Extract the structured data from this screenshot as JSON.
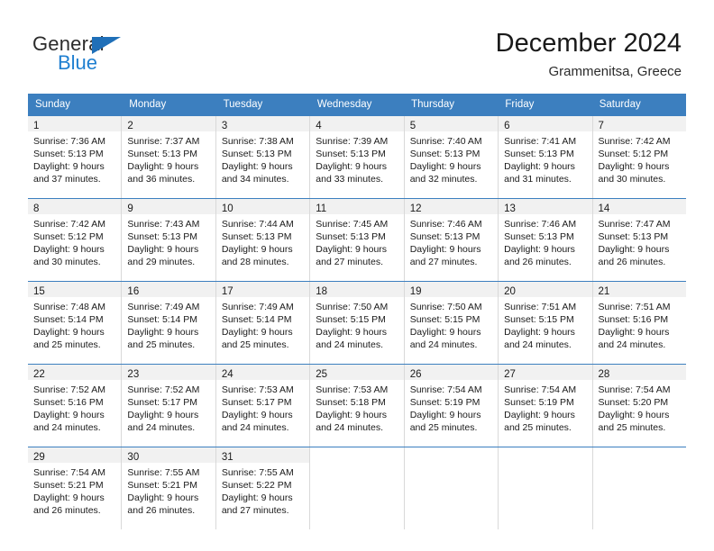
{
  "brand": {
    "word_one": "General",
    "word_two": "Blue",
    "triangle_icon": "triangle-icon",
    "accent_color": "#1f7fd0"
  },
  "header": {
    "title": "December 2024",
    "subtitle": "Grammenitsa, Greece"
  },
  "calendar": {
    "header_bg": "#3c7fbf",
    "daynum_bg": "#f1f1f1",
    "weekdays": [
      "Sunday",
      "Monday",
      "Tuesday",
      "Wednesday",
      "Thursday",
      "Friday",
      "Saturday"
    ],
    "weeks": [
      [
        {
          "day": "1",
          "sunrise": "Sunrise: 7:36 AM",
          "sunset": "Sunset: 5:13 PM",
          "daylight_1": "Daylight: 9 hours",
          "daylight_2": "and 37 minutes."
        },
        {
          "day": "2",
          "sunrise": "Sunrise: 7:37 AM",
          "sunset": "Sunset: 5:13 PM",
          "daylight_1": "Daylight: 9 hours",
          "daylight_2": "and 36 minutes."
        },
        {
          "day": "3",
          "sunrise": "Sunrise: 7:38 AM",
          "sunset": "Sunset: 5:13 PM",
          "daylight_1": "Daylight: 9 hours",
          "daylight_2": "and 34 minutes."
        },
        {
          "day": "4",
          "sunrise": "Sunrise: 7:39 AM",
          "sunset": "Sunset: 5:13 PM",
          "daylight_1": "Daylight: 9 hours",
          "daylight_2": "and 33 minutes."
        },
        {
          "day": "5",
          "sunrise": "Sunrise: 7:40 AM",
          "sunset": "Sunset: 5:13 PM",
          "daylight_1": "Daylight: 9 hours",
          "daylight_2": "and 32 minutes."
        },
        {
          "day": "6",
          "sunrise": "Sunrise: 7:41 AM",
          "sunset": "Sunset: 5:13 PM",
          "daylight_1": "Daylight: 9 hours",
          "daylight_2": "and 31 minutes."
        },
        {
          "day": "7",
          "sunrise": "Sunrise: 7:42 AM",
          "sunset": "Sunset: 5:12 PM",
          "daylight_1": "Daylight: 9 hours",
          "daylight_2": "and 30 minutes."
        }
      ],
      [
        {
          "day": "8",
          "sunrise": "Sunrise: 7:42 AM",
          "sunset": "Sunset: 5:12 PM",
          "daylight_1": "Daylight: 9 hours",
          "daylight_2": "and 30 minutes."
        },
        {
          "day": "9",
          "sunrise": "Sunrise: 7:43 AM",
          "sunset": "Sunset: 5:13 PM",
          "daylight_1": "Daylight: 9 hours",
          "daylight_2": "and 29 minutes."
        },
        {
          "day": "10",
          "sunrise": "Sunrise: 7:44 AM",
          "sunset": "Sunset: 5:13 PM",
          "daylight_1": "Daylight: 9 hours",
          "daylight_2": "and 28 minutes."
        },
        {
          "day": "11",
          "sunrise": "Sunrise: 7:45 AM",
          "sunset": "Sunset: 5:13 PM",
          "daylight_1": "Daylight: 9 hours",
          "daylight_2": "and 27 minutes."
        },
        {
          "day": "12",
          "sunrise": "Sunrise: 7:46 AM",
          "sunset": "Sunset: 5:13 PM",
          "daylight_1": "Daylight: 9 hours",
          "daylight_2": "and 27 minutes."
        },
        {
          "day": "13",
          "sunrise": "Sunrise: 7:46 AM",
          "sunset": "Sunset: 5:13 PM",
          "daylight_1": "Daylight: 9 hours",
          "daylight_2": "and 26 minutes."
        },
        {
          "day": "14",
          "sunrise": "Sunrise: 7:47 AM",
          "sunset": "Sunset: 5:13 PM",
          "daylight_1": "Daylight: 9 hours",
          "daylight_2": "and 26 minutes."
        }
      ],
      [
        {
          "day": "15",
          "sunrise": "Sunrise: 7:48 AM",
          "sunset": "Sunset: 5:14 PM",
          "daylight_1": "Daylight: 9 hours",
          "daylight_2": "and 25 minutes."
        },
        {
          "day": "16",
          "sunrise": "Sunrise: 7:49 AM",
          "sunset": "Sunset: 5:14 PM",
          "daylight_1": "Daylight: 9 hours",
          "daylight_2": "and 25 minutes."
        },
        {
          "day": "17",
          "sunrise": "Sunrise: 7:49 AM",
          "sunset": "Sunset: 5:14 PM",
          "daylight_1": "Daylight: 9 hours",
          "daylight_2": "and 25 minutes."
        },
        {
          "day": "18",
          "sunrise": "Sunrise: 7:50 AM",
          "sunset": "Sunset: 5:15 PM",
          "daylight_1": "Daylight: 9 hours",
          "daylight_2": "and 24 minutes."
        },
        {
          "day": "19",
          "sunrise": "Sunrise: 7:50 AM",
          "sunset": "Sunset: 5:15 PM",
          "daylight_1": "Daylight: 9 hours",
          "daylight_2": "and 24 minutes."
        },
        {
          "day": "20",
          "sunrise": "Sunrise: 7:51 AM",
          "sunset": "Sunset: 5:15 PM",
          "daylight_1": "Daylight: 9 hours",
          "daylight_2": "and 24 minutes."
        },
        {
          "day": "21",
          "sunrise": "Sunrise: 7:51 AM",
          "sunset": "Sunset: 5:16 PM",
          "daylight_1": "Daylight: 9 hours",
          "daylight_2": "and 24 minutes."
        }
      ],
      [
        {
          "day": "22",
          "sunrise": "Sunrise: 7:52 AM",
          "sunset": "Sunset: 5:16 PM",
          "daylight_1": "Daylight: 9 hours",
          "daylight_2": "and 24 minutes."
        },
        {
          "day": "23",
          "sunrise": "Sunrise: 7:52 AM",
          "sunset": "Sunset: 5:17 PM",
          "daylight_1": "Daylight: 9 hours",
          "daylight_2": "and 24 minutes."
        },
        {
          "day": "24",
          "sunrise": "Sunrise: 7:53 AM",
          "sunset": "Sunset: 5:17 PM",
          "daylight_1": "Daylight: 9 hours",
          "daylight_2": "and 24 minutes."
        },
        {
          "day": "25",
          "sunrise": "Sunrise: 7:53 AM",
          "sunset": "Sunset: 5:18 PM",
          "daylight_1": "Daylight: 9 hours",
          "daylight_2": "and 24 minutes."
        },
        {
          "day": "26",
          "sunrise": "Sunrise: 7:54 AM",
          "sunset": "Sunset: 5:19 PM",
          "daylight_1": "Daylight: 9 hours",
          "daylight_2": "and 25 minutes."
        },
        {
          "day": "27",
          "sunrise": "Sunrise: 7:54 AM",
          "sunset": "Sunset: 5:19 PM",
          "daylight_1": "Daylight: 9 hours",
          "daylight_2": "and 25 minutes."
        },
        {
          "day": "28",
          "sunrise": "Sunrise: 7:54 AM",
          "sunset": "Sunset: 5:20 PM",
          "daylight_1": "Daylight: 9 hours",
          "daylight_2": "and 25 minutes."
        }
      ],
      [
        {
          "day": "29",
          "sunrise": "Sunrise: 7:54 AM",
          "sunset": "Sunset: 5:21 PM",
          "daylight_1": "Daylight: 9 hours",
          "daylight_2": "and 26 minutes."
        },
        {
          "day": "30",
          "sunrise": "Sunrise: 7:55 AM",
          "sunset": "Sunset: 5:21 PM",
          "daylight_1": "Daylight: 9 hours",
          "daylight_2": "and 26 minutes."
        },
        {
          "day": "31",
          "sunrise": "Sunrise: 7:55 AM",
          "sunset": "Sunset: 5:22 PM",
          "daylight_1": "Daylight: 9 hours",
          "daylight_2": "and 27 minutes."
        },
        {
          "day": "",
          "sunrise": "",
          "sunset": "",
          "daylight_1": "",
          "daylight_2": ""
        },
        {
          "day": "",
          "sunrise": "",
          "sunset": "",
          "daylight_1": "",
          "daylight_2": ""
        },
        {
          "day": "",
          "sunrise": "",
          "sunset": "",
          "daylight_1": "",
          "daylight_2": ""
        },
        {
          "day": "",
          "sunrise": "",
          "sunset": "",
          "daylight_1": "",
          "daylight_2": ""
        }
      ]
    ]
  }
}
